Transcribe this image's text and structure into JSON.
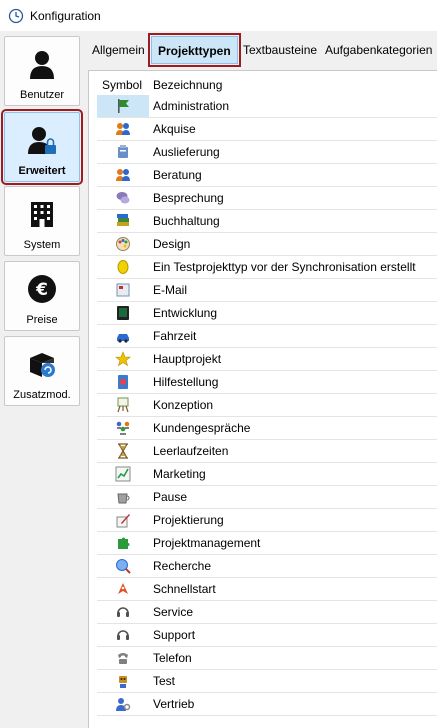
{
  "window": {
    "title": "Konfiguration"
  },
  "sidebar": {
    "items": [
      {
        "label": "Benutzer",
        "icon": "user-icon"
      },
      {
        "label": "Erweitert",
        "icon": "user-lock-icon",
        "active": true
      },
      {
        "label": "System",
        "icon": "building-icon"
      },
      {
        "label": "Preise",
        "icon": "euro-icon"
      },
      {
        "label": "Zusatzmod.",
        "icon": "box-module-icon"
      }
    ]
  },
  "tabs": [
    {
      "label": "Allgemein"
    },
    {
      "label": "Projekttypen",
      "active": true
    },
    {
      "label": "Textbausteine"
    },
    {
      "label": "Aufgabenkategorien"
    }
  ],
  "grid": {
    "columns": {
      "symbol": "Symbol",
      "name": "Bezeichnung"
    },
    "rows": [
      {
        "name": "Administration",
        "icon": "flag-icon",
        "color": "#2e8b2e"
      },
      {
        "name": "Akquise",
        "icon": "people-icon",
        "color": "#e07a1a"
      },
      {
        "name": "Auslieferung",
        "icon": "package-icon",
        "color": "#6a8fc8"
      },
      {
        "name": "Beratung",
        "icon": "people-icon",
        "color": "#e07a1a"
      },
      {
        "name": "Besprechung",
        "icon": "chat-icon",
        "color": "#8a7ab8"
      },
      {
        "name": "Buchhaltung",
        "icon": "books-icon",
        "color": "#c8a020"
      },
      {
        "name": "Design",
        "icon": "palette-icon",
        "color": "#d04040"
      },
      {
        "name": "Ein Testprojekttyp vor der Synchronisation erstellt",
        "icon": "yellow-dot-icon",
        "color": "#f2d100"
      },
      {
        "name": "E-Mail",
        "icon": "mail-icon",
        "color": "#7a8fb0"
      },
      {
        "name": "Entwicklung",
        "icon": "terminal-icon",
        "color": "#1a6a3a"
      },
      {
        "name": "Fahrzeit",
        "icon": "car-icon",
        "color": "#2a6ad0"
      },
      {
        "name": "Hauptprojekt",
        "icon": "star-icon",
        "color": "#f2c200"
      },
      {
        "name": "Hilfestellung",
        "icon": "help-book-icon",
        "color": "#3a7ad0"
      },
      {
        "name": "Konzeption",
        "icon": "easel-icon",
        "color": "#6a9a4a"
      },
      {
        "name": "Kundengespräche",
        "icon": "group-icon",
        "color": "#3a6ad0"
      },
      {
        "name": "Leerlaufzeiten",
        "icon": "hourglass-icon",
        "color": "#c8a040"
      },
      {
        "name": "Marketing",
        "icon": "chart-icon",
        "color": "#2a9a4a"
      },
      {
        "name": "Pause",
        "icon": "cup-icon",
        "color": "#a0a0a0"
      },
      {
        "name": "Projektierung",
        "icon": "pencil-icon",
        "color": "#c03030"
      },
      {
        "name": "Projektmanagement",
        "icon": "puzzle-icon",
        "color": "#2a9a3a"
      },
      {
        "name": "Recherche",
        "icon": "globe-search-icon",
        "color": "#2a6ad0"
      },
      {
        "name": "Schnellstart",
        "icon": "rocket-icon",
        "color": "#e05020"
      },
      {
        "name": "Service",
        "icon": "headset-icon",
        "color": "#505050"
      },
      {
        "name": "Support",
        "icon": "headset-icon",
        "color": "#505050"
      },
      {
        "name": "Telefon",
        "icon": "phone-icon",
        "color": "#808080"
      },
      {
        "name": "Test",
        "icon": "robot-icon",
        "color": "#c89020"
      },
      {
        "name": "Vertrieb",
        "icon": "person-gear-icon",
        "color": "#3a6ad0"
      }
    ]
  }
}
